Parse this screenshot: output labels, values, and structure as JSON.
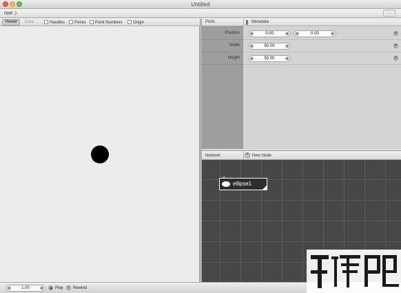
{
  "window": {
    "title": "Untitled"
  },
  "pathbar": {
    "crumb": "root"
  },
  "viewer": {
    "tabs": [
      "Viewer",
      "Data"
    ],
    "active_tab": "Viewer",
    "options": [
      {
        "label": "Handles",
        "checked": false
      },
      {
        "label": "Points",
        "checked": false
      },
      {
        "label": "Point Numbers",
        "checked": false
      },
      {
        "label": "Origin",
        "checked": false
      }
    ]
  },
  "ports": {
    "header": "Ports",
    "metadata_label": "Metadata",
    "rows": [
      {
        "label": "Position",
        "values": [
          "0.00",
          "0.00"
        ]
      },
      {
        "label": "Width",
        "values": [
          "50.00"
        ]
      },
      {
        "label": "Height",
        "values": [
          "50.00"
        ]
      }
    ]
  },
  "network": {
    "header": "Network",
    "new_node_label": "New Node",
    "node": {
      "label": "ellipse1"
    }
  },
  "transport": {
    "frame": "1.00",
    "play_label": "Play",
    "rewind_label": "Rewind"
  },
  "colors": {
    "canvas_bg": "#ececec",
    "network_bg": "#474747",
    "close": "#ee5d55",
    "minimize": "#f4be4f",
    "maximize": "#61c454"
  }
}
